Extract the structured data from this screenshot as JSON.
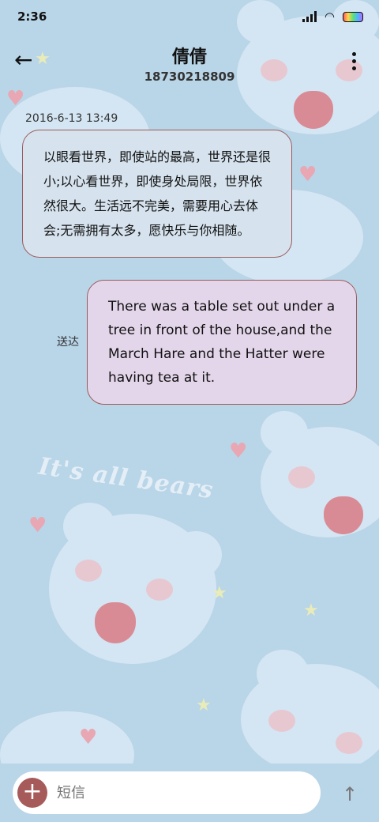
{
  "status_bar": {
    "time": "2:36"
  },
  "header": {
    "contact_name": "倩倩",
    "contact_number": "18730218809"
  },
  "messages": [
    {
      "direction": "incoming",
      "timestamp": "2016-6-13 13:49",
      "text": "以眼看世界，即使站的最高，世界还是很小;以心看世界，即使身处局限，世界依然很大。生活远不完美，需要用心去体会;无需拥有太多，愿快乐与你相随。"
    },
    {
      "direction": "outgoing",
      "status": "送达",
      "text": "There was a table set out under a tree in front of the house,and the March Hare and the Hatter were having tea at it."
    }
  ],
  "wallpaper": {
    "text": "It's all bears"
  },
  "composer": {
    "placeholder": "短信"
  },
  "colors": {
    "background": "#b9d5e8",
    "incoming_bubble": "#d6e3ee",
    "outgoing_bubble": "#e4d6ea",
    "bubble_border": "#9b5a5a",
    "add_button": "#a75a5a"
  }
}
